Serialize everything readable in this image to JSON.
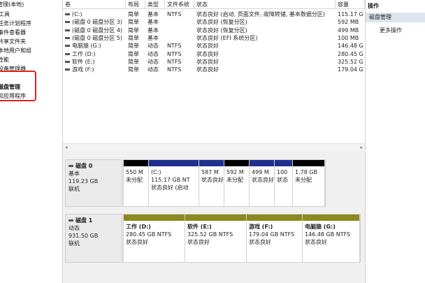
{
  "nav": {
    "items": [
      {
        "label": "管理(本地)"
      },
      {
        "label": "工具"
      },
      {
        "label": "任务计划程序"
      },
      {
        "label": "事件查看器"
      },
      {
        "label": "共享文件夹"
      },
      {
        "label": "本地用户和组"
      },
      {
        "label": "性能"
      },
      {
        "label": "设备管理器"
      },
      {
        "label": "磁盘管理"
      },
      {
        "label": "和应用程序"
      }
    ]
  },
  "table": {
    "columns": [
      "卷",
      "布局",
      "类型",
      "文件系统",
      "状态",
      "容量"
    ],
    "rows": [
      {
        "vol": "(C:)",
        "layout": "简单",
        "type": "基本",
        "fs": "NTFS",
        "status": "状态良好 (启动, 页面文件, 故障转储, 基本数据分区)",
        "cap": "115.17 G"
      },
      {
        "vol": "(磁盘 0 磁盘分区 3)",
        "layout": "简单",
        "type": "基本",
        "fs": "",
        "status": "状态良好 (恢复分区)",
        "cap": "592 MB"
      },
      {
        "vol": "(磁盘 0 磁盘分区 4)",
        "layout": "简单",
        "type": "基本",
        "fs": "",
        "status": "状态良好 (恢复分区)",
        "cap": "499 MB"
      },
      {
        "vol": "(磁盘 0 磁盘分区 5)",
        "layout": "简单",
        "type": "基本",
        "fs": "",
        "status": "状态良好 (EFI 系统分区)",
        "cap": "100 MB"
      },
      {
        "vol": "电脑猿 (G:)",
        "layout": "简单",
        "type": "动态",
        "fs": "NTFS",
        "status": "状态良好",
        "cap": "146.48 G"
      },
      {
        "vol": "工作 (D:)",
        "layout": "简单",
        "type": "动态",
        "fs": "NTFS",
        "status": "状态良好",
        "cap": "280.45 G"
      },
      {
        "vol": "软件 (E:)",
        "layout": "简单",
        "type": "动态",
        "fs": "NTFS",
        "status": "状态良好",
        "cap": "325.52 G"
      },
      {
        "vol": "游戏 (F:)",
        "layout": "简单",
        "type": "动态",
        "fs": "NTFS",
        "status": "状态良好",
        "cap": "179.04 G"
      }
    ]
  },
  "disks": [
    {
      "name": "磁盘 0",
      "kind": "基本",
      "size": "119.23 GB",
      "state": "联机",
      "partitions": [
        {
          "l1": "550 M",
          "l2": "未分配",
          "l3": "",
          "color": "#000000"
        },
        {
          "l1": "(C:)",
          "l2": "115.17 GB NT",
          "l3": "状态良好 (启动",
          "color": "#1f2f8f"
        },
        {
          "l1": "587 M",
          "l2": "状态良好",
          "l3": "",
          "color": "#1f2f8f"
        },
        {
          "l1": "592 M",
          "l2": "未分配",
          "l3": "",
          "color": "#000000"
        },
        {
          "l1": "499 M",
          "l2": "状态良好",
          "l3": "",
          "color": "#1f2f8f"
        },
        {
          "l1": "100",
          "l2": "状态",
          "l3": "",
          "color": "#1f2f8f"
        },
        {
          "l1": "1.78 GB",
          "l2": "未分配",
          "l3": "",
          "color": "#000000"
        }
      ]
    },
    {
      "name": "磁盘 1",
      "kind": "动态",
      "size": "931.50 GB",
      "state": "联机",
      "partitions": [
        {
          "l1": "工作 (D:)",
          "l2": "280.45 GB NTFS",
          "l3": "状态良好",
          "color": "#8a8a1e"
        },
        {
          "l1": "软件 (E:)",
          "l2": "325.52 GB NTFS",
          "l3": "状态良好",
          "color": "#8a8a1e"
        },
        {
          "l1": "游戏 (F:)",
          "l2": "179.04 GB NTFS",
          "l3": "状态良好",
          "color": "#8a8a1e"
        },
        {
          "l1": "电脑猿 (G:)",
          "l2": "146.48 GB NTFS",
          "l3": "状态良好",
          "color": "#8a8a1e"
        }
      ]
    }
  ],
  "actions": {
    "title": "操作",
    "section": "磁盘管理",
    "more": "更多操作"
  },
  "icons": {
    "disk": "disk-icon",
    "volume": "volume-icon",
    "scroll_left": "scroll-left-arrow-icon",
    "scroll_right": "scroll-right-arrow-icon"
  }
}
